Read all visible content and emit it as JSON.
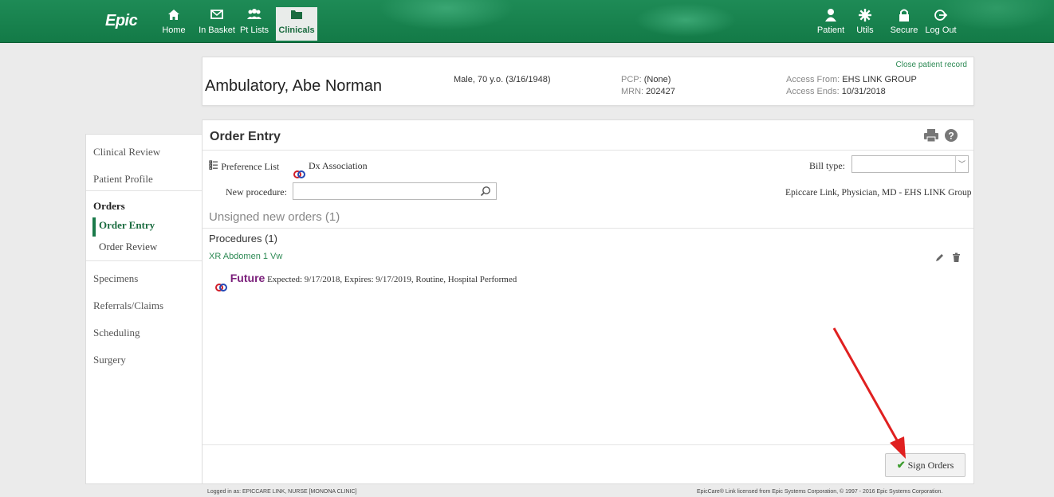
{
  "app": {
    "logo": "Epic",
    "nav": [
      {
        "label": "Home",
        "icon": "home-icon",
        "glyph": "⌂"
      },
      {
        "label": "In Basket",
        "icon": "envelope-icon",
        "glyph": "✉"
      },
      {
        "label": "Pt Lists",
        "icon": "people-icon",
        "glyph": "👥"
      },
      {
        "label": "Clinicals",
        "icon": "folder-icon",
        "glyph": "▬",
        "active": true
      }
    ],
    "nav_right": [
      {
        "label": "Patient",
        "icon": "person-icon",
        "glyph": "●"
      },
      {
        "label": "Utils",
        "icon": "gear-icon",
        "glyph": "✹"
      },
      {
        "label": "Secure",
        "icon": "lock-icon",
        "glyph": "🔒"
      },
      {
        "label": "Log Out",
        "icon": "logout-icon",
        "glyph": "⇥"
      }
    ]
  },
  "patient": {
    "name": "Ambulatory, Abe Norman",
    "demographics": "Male, 70 y.o. (3/16/1948)",
    "pcp_label": "PCP:",
    "pcp_value": "(None)",
    "mrn_label": "MRN:",
    "mrn_value": "202427",
    "access_from_label": "Access From:",
    "access_from_value": "EHS LINK GROUP",
    "access_ends_label": "Access Ends:",
    "access_ends_value": "10/31/2018",
    "close_link": "Close patient record"
  },
  "sidebar": {
    "items": [
      {
        "label": "Clinical Review"
      },
      {
        "label": "Patient Profile"
      },
      {
        "label": "Orders"
      },
      {
        "label": "Order Entry"
      },
      {
        "label": "Order Review"
      },
      {
        "label": "Specimens"
      },
      {
        "label": "Referrals/Claims"
      },
      {
        "label": "Scheduling"
      },
      {
        "label": "Surgery"
      }
    ]
  },
  "order_entry": {
    "title": "Order Entry",
    "preference_list": "Preference List",
    "dx_association": "Dx Association",
    "bill_type_label": "Bill type:",
    "bill_type_value": "",
    "new_procedure_label": "New procedure:",
    "new_procedure_value": "",
    "provider": "Epiccare Link, Physician, MD - EHS LINK Group",
    "unsigned_heading": "Unsigned new orders (1)",
    "procedures_heading": "Procedures (1)",
    "procedure_name": "XR Abdomen 1 Vw",
    "status_word": "Future",
    "status_details": "Expected: 9/17/2018, Expires: 9/17/2019, Routine, Hospital Performed",
    "sign_button": "Sign Orders"
  },
  "footer": {
    "logged_in": "Logged in as: EPICCARE LINK, NURSE [MONONA CLINIC]",
    "license": "EpicCare® Link licensed from Epic Systems Corporation, © 1997 - 2016 Epic Systems Corporation."
  },
  "annotation": {
    "arrow_color": "#e02020"
  }
}
